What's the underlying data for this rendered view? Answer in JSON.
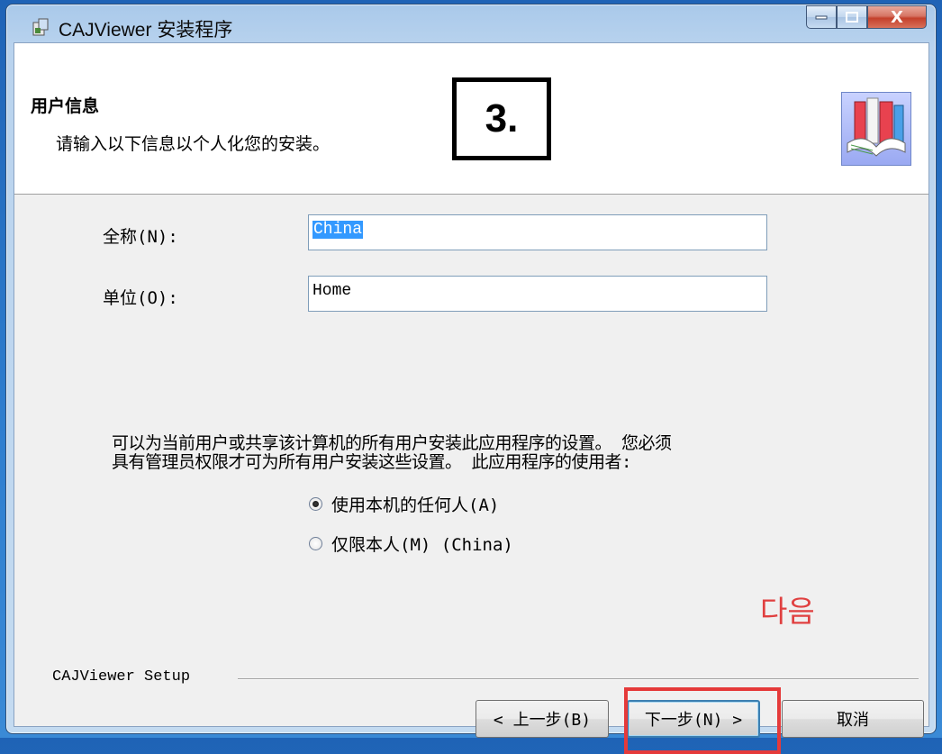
{
  "window": {
    "title": "CAJViewer 安装程序",
    "close_glyph": "X"
  },
  "header": {
    "title": "用户信息",
    "subtitle": "请输入以下信息以个人化您的安装。",
    "step_badge": "3."
  },
  "form": {
    "fullname_label": "全称(N):",
    "fullname_value": "China",
    "org_label": "单位(O):",
    "org_value": "Home"
  },
  "description": {
    "line1": "可以为当前用户或共享该计算机的所有用户安装此应用程序的设置。 您必须",
    "line2": "具有管理员权限才可为所有用户安装这些设置。 此应用程序的使用者:"
  },
  "options": [
    {
      "label": "使用本机的任何人(A)",
      "checked": true
    },
    {
      "label": "仅限本人(M) (China)",
      "checked": false
    }
  ],
  "annotation": {
    "korean_next": "다음"
  },
  "footer": {
    "setup_label": "CAJViewer Setup",
    "back_label": "< 上一步(B)",
    "next_label": "下一步(N) >",
    "cancel_label": "取消"
  },
  "colors": {
    "highlight": "#e53a3a",
    "selection": "#3399ff"
  }
}
